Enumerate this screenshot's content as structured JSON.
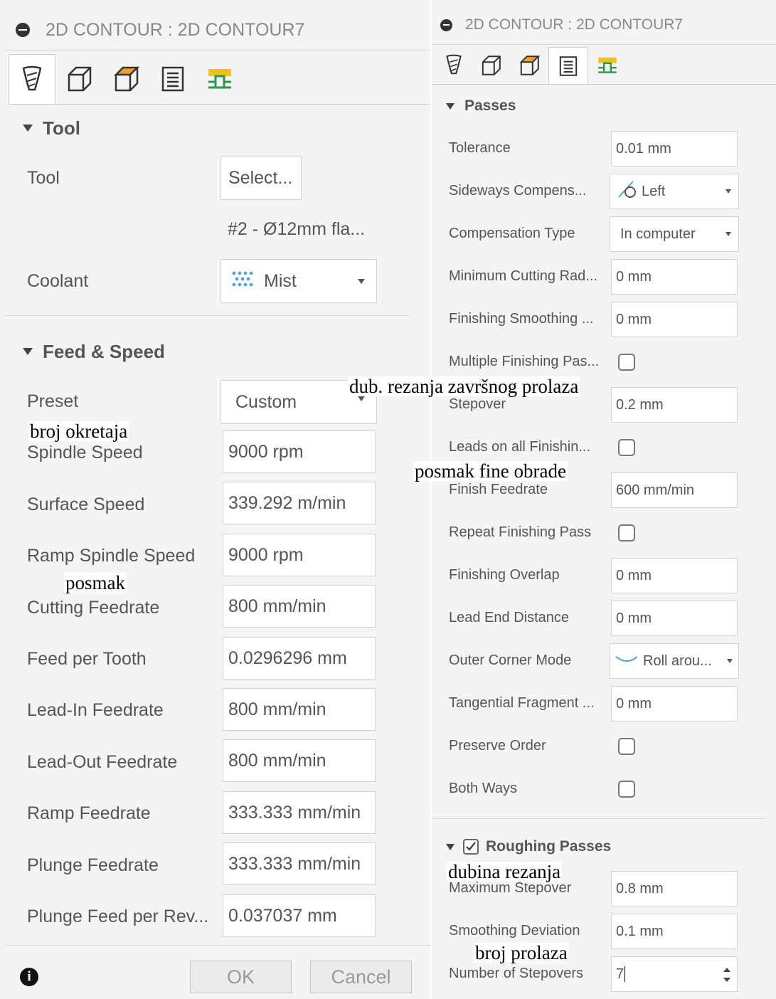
{
  "left": {
    "title": "2D CONTOUR : 2D CONTOUR7",
    "tabs": [
      "tool-icon",
      "geometry-icon",
      "heights-icon",
      "passes-icon",
      "linking-icon"
    ],
    "tool_section": {
      "title": "Tool",
      "tool_label": "Tool",
      "select_button": "Select...",
      "tool_name": "#2 - Ø12mm fla...",
      "coolant_label": "Coolant",
      "coolant_value": "Mist"
    },
    "feed_section": {
      "title": "Feed & Speed",
      "rows": [
        {
          "label": "Preset",
          "value": "Custom"
        },
        {
          "label": "Spindle Speed",
          "value": "9000 rpm"
        },
        {
          "label": "Surface Speed",
          "value": "339.292 m/min"
        },
        {
          "label": "Ramp Spindle Speed",
          "value": "9000 rpm"
        },
        {
          "label": "Cutting Feedrate",
          "value": "800 mm/min"
        },
        {
          "label": "Feed per Tooth",
          "value": "0.0296296 mm"
        },
        {
          "label": "Lead-In Feedrate",
          "value": "800 mm/min"
        },
        {
          "label": "Lead-Out Feedrate",
          "value": "800 mm/min"
        },
        {
          "label": "Ramp Feedrate",
          "value": "333.333 mm/min"
        },
        {
          "label": "Plunge Feedrate",
          "value": "333.333 mm/min"
        },
        {
          "label": "Plunge Feed per Rev...",
          "value": "0.037037 mm"
        }
      ]
    },
    "ok_label": "OK",
    "cancel_label": "Cancel"
  },
  "right": {
    "title": "2D CONTOUR : 2D CONTOUR7",
    "passes_title": "Passes",
    "rows": [
      {
        "label": "Tolerance",
        "value": "0.01 mm"
      },
      {
        "label": "Sideways Compens...",
        "value": "Left"
      },
      {
        "label": "Compensation Type",
        "value": "In computer"
      },
      {
        "label": "Minimum Cutting Rad...",
        "value": "0 mm"
      },
      {
        "label": "Finishing Smoothing ...",
        "value": "0 mm"
      },
      {
        "label": "Multiple Finishing Pas...",
        "checked": false
      },
      {
        "label": "Stepover",
        "value": "0.2 mm"
      },
      {
        "label": "Leads on all Finishin...",
        "checked": false
      },
      {
        "label": "Finish Feedrate",
        "value": "600 mm/min"
      },
      {
        "label": "Repeat Finishing Pass",
        "checked": false
      },
      {
        "label": "Finishing Overlap",
        "value": "0 mm"
      },
      {
        "label": "Lead End Distance",
        "value": "0 mm"
      },
      {
        "label": "Outer Corner Mode",
        "value": "Roll arou..."
      },
      {
        "label": "Tangential Fragment ...",
        "value": "0 mm"
      },
      {
        "label": "Preserve Order",
        "checked": false
      },
      {
        "label": "Both Ways",
        "checked": false
      }
    ],
    "roughing_title": "Roughing Passes",
    "roughing_checked": true,
    "roughing_rows": [
      {
        "label": "Maximum Stepover",
        "value": "0.8 mm"
      },
      {
        "label": "Smoothing Deviation",
        "value": "0.1 mm"
      },
      {
        "label": "Number of Stepovers",
        "value": "7"
      }
    ]
  },
  "annotations": {
    "spindle": "broj okretaja",
    "cutting": "posmak",
    "stepover": "dub. rezanja završnog prolaza",
    "finish_feed": "posmak fine obrade",
    "max_stepover": "dubina rezanja",
    "num_stepovers": "broj prolaza"
  },
  "colors": {
    "panel_bg": "#f4f4f4",
    "field_bg": "#ffffff",
    "border": "#d2d2d2",
    "text": "#555555",
    "icon_orange": "#f0a030",
    "icon_green": "#2a9a4a",
    "coolant_blue": "#4aa0e0"
  }
}
